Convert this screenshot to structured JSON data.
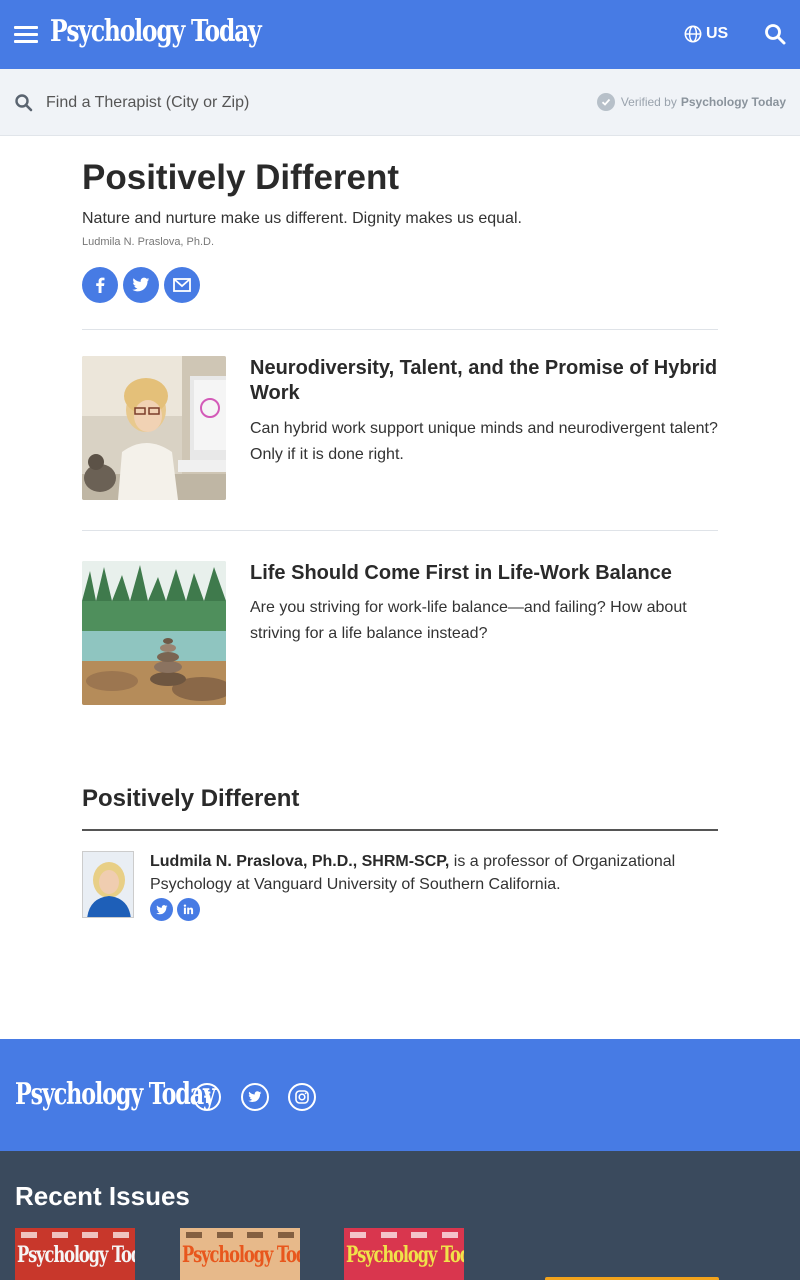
{
  "header": {
    "logo_text": "Psychology Today",
    "country_label": "US"
  },
  "therapist_search": {
    "placeholder": "Find a Therapist (City or Zip)",
    "verified_prefix": "Verified by",
    "verified_brand": "Psychology Today"
  },
  "blog": {
    "title": "Positively Different",
    "tagline": "Nature and nurture make us different. Dignity makes us equal.",
    "author": "Ludmila N. Praslova, Ph.D."
  },
  "articles": [
    {
      "title": "Neurodiversity, Talent, and the Promise of Hybrid Work",
      "description": "Can hybrid work support unique minds and neurodivergent talent? Only if it is done right."
    },
    {
      "title": "Life Should Come First in Life-Work Balance",
      "description": "Are you striving for work-life balance—and failing? How about striving for a life balance instead?"
    }
  ],
  "about": {
    "title": "Positively Different",
    "author_name": "Ludmila N. Praslova, Ph.D., SHRM-SCP,",
    "bio_text": " is a professor of Organizational Psychology at Vanguard University of Southern California."
  },
  "footer": {
    "logo_text": "Psychology Today",
    "recent_issues_title": "Recent Issues",
    "issue_masthead": "Psychology Today"
  },
  "colors": {
    "brand_blue": "#477be4",
    "footer_dark": "#3a4a5d"
  },
  "icons": {
    "menu": "hamburger-icon",
    "globe": "globe-icon",
    "search": "search-icon",
    "facebook": "facebook-icon",
    "twitter": "twitter-icon",
    "email": "email-icon",
    "linkedin": "linkedin-icon",
    "instagram": "instagram-icon",
    "verified": "checkmark-icon"
  }
}
